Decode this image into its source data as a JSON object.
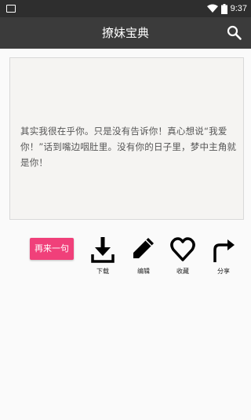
{
  "status_bar": {
    "time": "9:37"
  },
  "app_bar": {
    "title": "撩妹宝典",
    "search_icon": "search-icon"
  },
  "quote": {
    "text": "其实我很在乎你。只是没有告诉你！真心想说“我爱你！”话到嘴边咽肚里。没有你的日子里，梦中主角就是你！"
  },
  "buttons": {
    "again": "再来一句"
  },
  "actions": [
    {
      "icon": "download-icon",
      "label": "下载"
    },
    {
      "icon": "pencil-icon",
      "label": "编辑"
    },
    {
      "icon": "heart-icon",
      "label": "收藏"
    },
    {
      "icon": "share-arrow-icon",
      "label": "分享"
    }
  ],
  "colors": {
    "app_bar": "#3b3b3b",
    "status_bar": "#2e2e2e",
    "accent_button": "#f0407a"
  }
}
